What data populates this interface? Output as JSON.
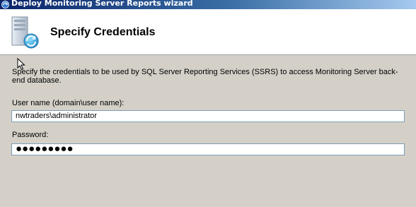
{
  "window": {
    "title": "Deploy Monitoring Server Reports wizard"
  },
  "header": {
    "title": "Specify Credentials",
    "icon": "server-sync-icon"
  },
  "main": {
    "description": "Specify the credentials to be used by SQL Server Reporting Services (SSRS) to access Monitoring Server back-end database.",
    "username": {
      "label": "User name (domain\\user name):",
      "value": "nwtraders\\administrator"
    },
    "password": {
      "label": "Password:",
      "value": "●●●●●●●●●"
    }
  },
  "colors": {
    "titlebar_start": "#0a246a",
    "titlebar_end": "#a6caf0",
    "panel_background": "#d4d0c8",
    "header_background": "#ffffff",
    "field_border": "#7f9db9"
  }
}
